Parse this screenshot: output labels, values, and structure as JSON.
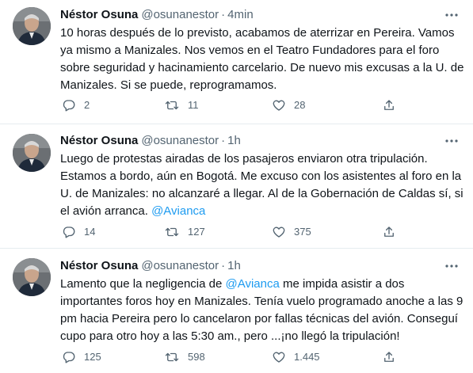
{
  "tweets": [
    {
      "author": "Néstor Osuna",
      "handle": "@osunanestor",
      "separator": "·",
      "time": "4min",
      "text_parts": [
        {
          "text": "10 horas después de lo previsto, acabamos de aterrizar en Pereira. Vamos ya mismo a Manizales. Nos vemos en el Teatro Fundadores para el foro sobre seguridad y hacinamiento carcelario. De nuevo mis excusas a la U. de Manizales. Si se puede, reprogramamos."
        }
      ],
      "replies": "2",
      "retweets": "11",
      "likes": "28"
    },
    {
      "author": "Néstor Osuna",
      "handle": "@osunanestor",
      "separator": "·",
      "time": "1h",
      "text_parts": [
        {
          "text": "Luego de protestas airadas de los pasajeros enviaron otra tripulación. Estamos a bordo, aún en Bogotá. Me excuso con los asistentes al foro en la U. de Manizales: no alcanzaré a llegar. Al de la Gobernación de Caldas sí, si el avión arranca. "
        },
        {
          "text": "@Avianca",
          "mention": true
        }
      ],
      "replies": "14",
      "retweets": "127",
      "likes": "375"
    },
    {
      "author": "Néstor Osuna",
      "handle": "@osunanestor",
      "separator": "·",
      "time": "1h",
      "text_parts": [
        {
          "text": "Lamento que la negligencia de "
        },
        {
          "text": "@Avianca",
          "mention": true
        },
        {
          "text": " me impida asistir a dos importantes foros hoy en Manizales. Tenía vuelo programado anoche a las 9 pm hacia Pereira pero lo cancelaron por fallas técnicas del avión. Conseguí cupo para otro hoy a las 5:30 am., pero ...¡no llegó la tripulación!"
        }
      ],
      "replies": "125",
      "retweets": "598",
      "likes": "1.445"
    }
  ],
  "icons": {
    "reply": "reply-icon",
    "retweet": "retweet-icon",
    "like": "heart-icon",
    "share": "share-icon",
    "more": "more-options-icon"
  },
  "colors": {
    "text": "#0f1419",
    "secondary": "#536471",
    "mention": "#1d9bf0",
    "divider": "#e6ecf0"
  }
}
